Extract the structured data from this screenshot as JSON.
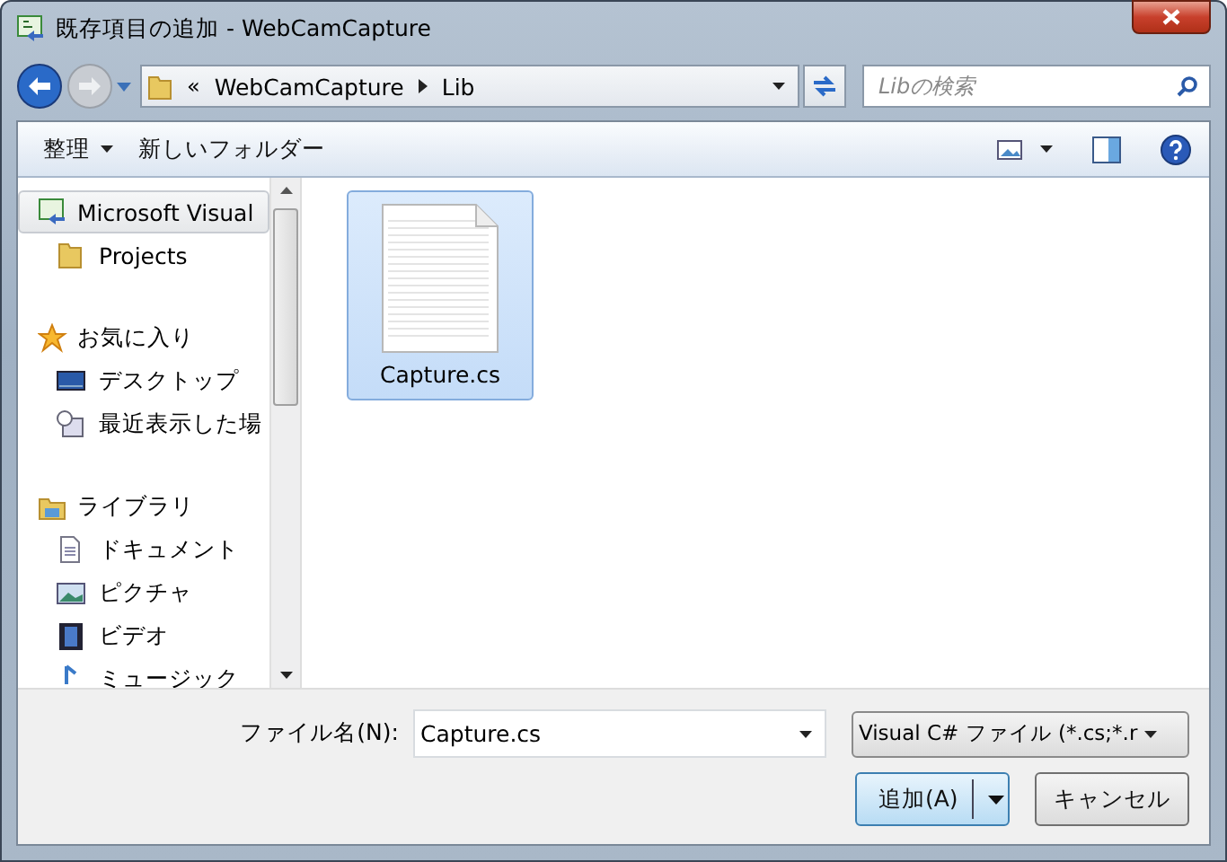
{
  "window": {
    "title": "既存項目の追加 - WebCamCapture"
  },
  "address": {
    "overflow": "«",
    "breadcrumb": [
      "WebCamCapture",
      "Lib"
    ]
  },
  "search": {
    "placeholder": "Libの検索"
  },
  "toolbar": {
    "organize": "整理",
    "new_folder": "新しいフォルダー"
  },
  "sidebar": {
    "items": [
      {
        "label": "Microsoft Visual",
        "kind": "project",
        "selected": true,
        "children": [
          {
            "label": "Projects",
            "kind": "folder",
            "selected": false
          }
        ]
      },
      {
        "label": "お気に入り",
        "kind": "star",
        "selected": false,
        "children": [
          {
            "label": "デスクトップ",
            "kind": "desktop",
            "selected": false
          },
          {
            "label": "最近表示した場",
            "kind": "recent",
            "selected": false
          }
        ]
      },
      {
        "label": "ライブラリ",
        "kind": "library",
        "selected": false,
        "children": [
          {
            "label": "ドキュメント",
            "kind": "document",
            "selected": false
          },
          {
            "label": "ピクチャ",
            "kind": "picture",
            "selected": false
          },
          {
            "label": "ビデオ",
            "kind": "video",
            "selected": false
          },
          {
            "label": "ミュージック",
            "kind": "music",
            "selected": false
          }
        ]
      }
    ]
  },
  "files": [
    {
      "name": "Capture.cs",
      "selected": true
    }
  ],
  "footer": {
    "file_name_label": "ファイル名(N):",
    "file_name": "Capture.cs",
    "file_type": "Visual C# ファイル (*.cs;*.r",
    "add_button": "追加(A)",
    "cancel_button": "キャンセル"
  }
}
